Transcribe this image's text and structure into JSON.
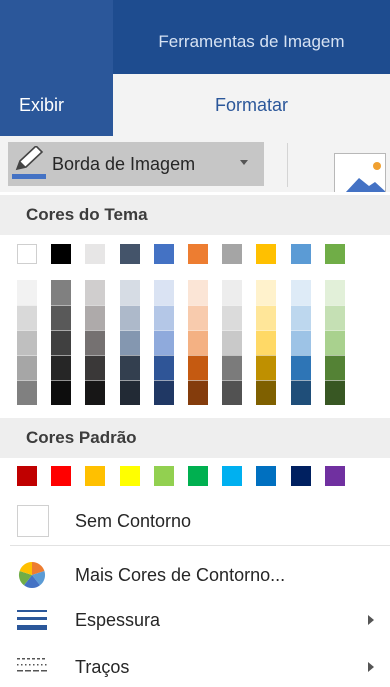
{
  "ribbon": {
    "context_title": "Ferramentas de Imagem",
    "tabs": [
      {
        "label": "Exibir"
      },
      {
        "label": "Formatar"
      }
    ]
  },
  "toolbar": {
    "picture_border_label": "Borda de Imagem",
    "picture_border_icon": "pen-color-icon",
    "accent_color": "#2b579a",
    "underline_color": "#4472c4"
  },
  "menu": {
    "theme_colors_header": "Cores do Tema",
    "standard_colors_header": "Cores Padrão",
    "theme_colors": [
      {
        "base": "#ffffff",
        "shades": [
          "#f2f2f2",
          "#d9d9d9",
          "#bfbfbf",
          "#a6a6a6",
          "#808080"
        ]
      },
      {
        "base": "#000000",
        "shades": [
          "#808080",
          "#595959",
          "#404040",
          "#262626",
          "#0d0d0d"
        ]
      },
      {
        "base": "#e7e6e6",
        "shades": [
          "#d0cece",
          "#aeaaaa",
          "#757171",
          "#3a3838",
          "#171616"
        ]
      },
      {
        "base": "#44546a",
        "shades": [
          "#d6dce4",
          "#adb9ca",
          "#8497b0",
          "#333f4f",
          "#222a35"
        ]
      },
      {
        "base": "#4472c4",
        "shades": [
          "#dae3f3",
          "#b4c7e7",
          "#8faadc",
          "#2f5597",
          "#203864"
        ]
      },
      {
        "base": "#ed7d31",
        "shades": [
          "#fbe5d6",
          "#f8cbad",
          "#f4b183",
          "#c55a11",
          "#843c0c"
        ]
      },
      {
        "base": "#a5a5a5",
        "shades": [
          "#ededed",
          "#dbdbdb",
          "#c9c9c9",
          "#7b7b7b",
          "#525252"
        ]
      },
      {
        "base": "#ffc000",
        "shades": [
          "#fff2cc",
          "#ffe699",
          "#ffd966",
          "#bf9000",
          "#7f6000"
        ]
      },
      {
        "base": "#5b9bd5",
        "shades": [
          "#deebf7",
          "#bdd7ee",
          "#9dc3e6",
          "#2e75b6",
          "#1f4e79"
        ]
      },
      {
        "base": "#70ad47",
        "shades": [
          "#e2f0d9",
          "#c5e0b4",
          "#a9d18e",
          "#548235",
          "#385723"
        ]
      }
    ],
    "standard_colors": [
      "#c00000",
      "#ff0000",
      "#ffc000",
      "#ffff00",
      "#92d050",
      "#00b050",
      "#00b0f0",
      "#0070c0",
      "#002060",
      "#7030a0"
    ],
    "no_outline_label": "Sem Contorno",
    "more_colors_label": "Mais Cores de Contorno...",
    "more_colors_icon": "color-wheel-icon",
    "weight_label": "Espessura",
    "weight_icon": "line-weight-icon",
    "dashes_label": "Traços",
    "dashes_icon": "dash-style-icon"
  }
}
